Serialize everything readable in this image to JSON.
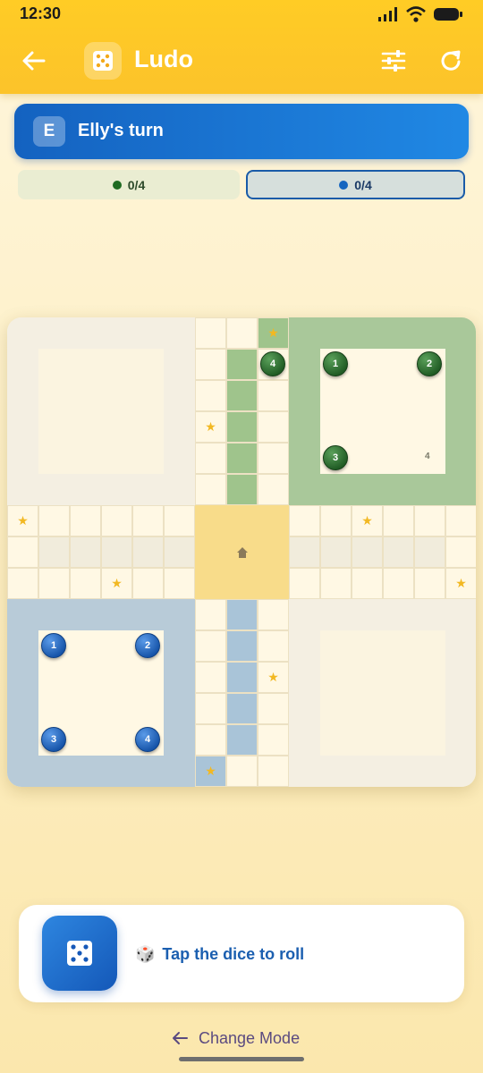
{
  "status_bar": {
    "time": "12:30"
  },
  "app_bar": {
    "title": "Ludo"
  },
  "turn_banner": {
    "avatar_letter": "E",
    "text": "Elly's turn"
  },
  "scores": [
    {
      "color": "#1f6b22",
      "text": "0/4"
    },
    {
      "color": "#1565c0",
      "text": "0/4"
    }
  ],
  "board": {
    "colors": {
      "green": "#9fc48c",
      "blue": "#a9c4d8",
      "yellow": "#f8dc8a"
    },
    "green_tokens": [
      "1",
      "2",
      "3",
      "4"
    ],
    "blue_tokens": [
      "1",
      "2",
      "3",
      "4"
    ],
    "green_finished_mark": "4"
  },
  "dice_panel": {
    "hint_emoji": "🎲",
    "hint_text": "Tap the dice to roll"
  },
  "footer": {
    "change_mode": "Change Mode"
  }
}
